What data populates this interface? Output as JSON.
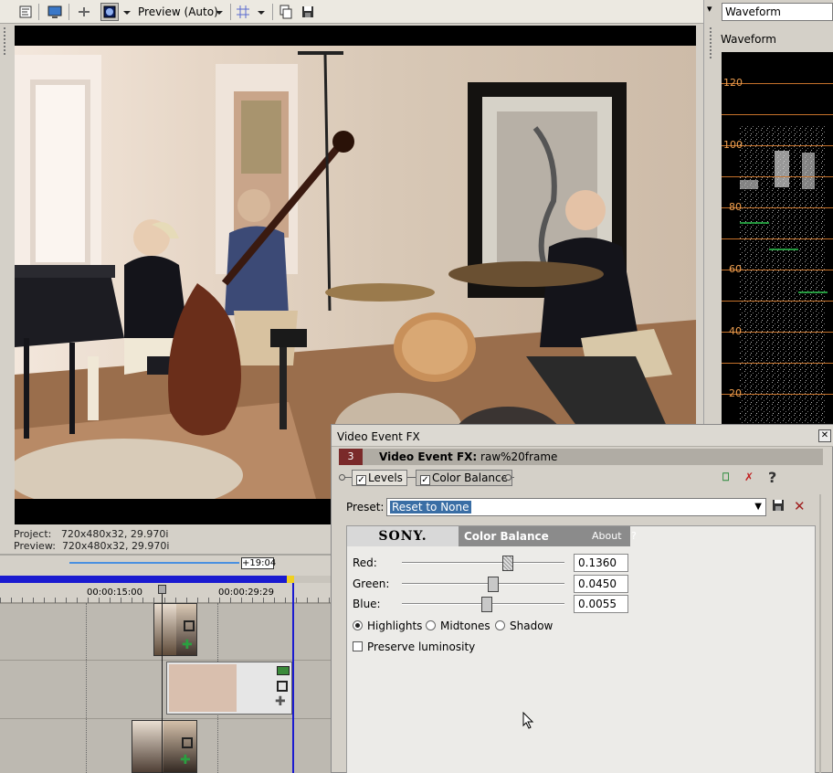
{
  "toolbar": {
    "preview_quality": "Preview (Auto)"
  },
  "preview": {
    "project_label": "Project:",
    "project_value": "720x480x32, 29.970i",
    "preview_label": "Preview:",
    "preview_value": "720x480x32, 29.970i"
  },
  "scope": {
    "selector": "Waveform",
    "panel_label": "Waveform",
    "levels": [
      "120",
      "100",
      "80",
      "60",
      "40",
      "20"
    ]
  },
  "timeline": {
    "marker": "+19:04",
    "time1": "00:00:15:00",
    "time2": "00:00:29:29"
  },
  "fx": {
    "window_title": "Video Event FX",
    "badge": "3",
    "header_bold": "Video Event FX:",
    "header_file": "raw%20frame",
    "chain": [
      "Levels",
      "Color Balance"
    ],
    "help": "?",
    "preset_label": "Preset:",
    "preset_value": "Reset to None",
    "plugin": {
      "brand": "SONY.",
      "name": "Color Balance",
      "about": "About",
      "about_help": "?",
      "sliders": [
        {
          "label": "Red:",
          "value": "0.1360"
        },
        {
          "label": "Green:",
          "value": "0.0450"
        },
        {
          "label": "Blue:",
          "value": "0.0055"
        }
      ],
      "modes": [
        "Highlights",
        "Midtones",
        "Shadow"
      ],
      "selected_mode": "Highlights",
      "preserve_label": "Preserve luminosity",
      "preserve_checked": false
    }
  }
}
